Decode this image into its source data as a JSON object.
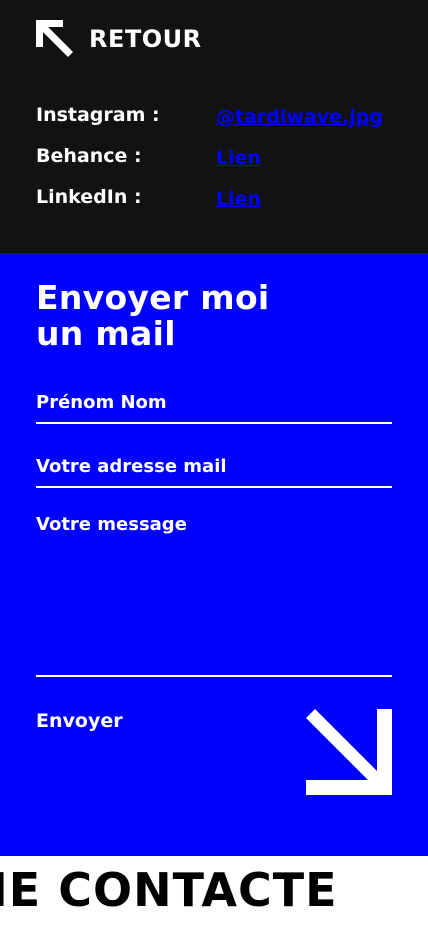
{
  "header": {
    "back_label": "RETOUR"
  },
  "socials": [
    {
      "label": "Instagram :",
      "link": "@tardiwave.jpg"
    },
    {
      "label": "Behance :",
      "link": "Lien"
    },
    {
      "label": "LinkedIn :",
      "link": "Lien"
    }
  ],
  "form": {
    "title_line1": "Envoyer moi",
    "title_line2": "un mail",
    "name_placeholder": "Prénom Nom",
    "email_placeholder": "Votre adresse mail",
    "message_placeholder": "Votre message",
    "submit_label": "Envoyer"
  },
  "marquee": {
    "text": "ME CONTACTE"
  },
  "colors": {
    "header_bg": "#121212",
    "accent_blue": "#0000ff",
    "text_white": "#ffffff",
    "marquee_bg": "#ffffff",
    "marquee_text": "#000000"
  },
  "icons": {
    "back": "arrow-up-left-icon",
    "send": "arrow-down-right-icon"
  }
}
